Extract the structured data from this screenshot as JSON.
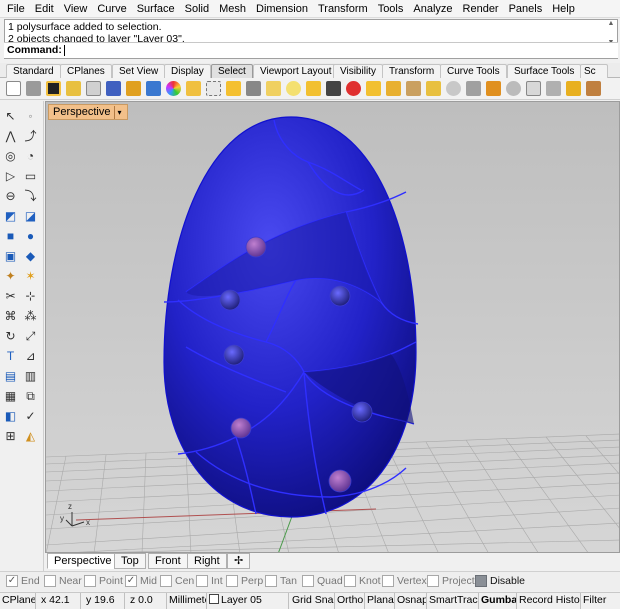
{
  "menu": [
    "File",
    "Edit",
    "View",
    "Curve",
    "Surface",
    "Solid",
    "Mesh",
    "Dimension",
    "Transform",
    "Tools",
    "Analyze",
    "Render",
    "Panels",
    "Help"
  ],
  "command_history": [
    "1 polysurface added to selection.",
    "2 objects changed to layer \"Layer 03\"."
  ],
  "command_prompt": "Command:",
  "toolbar_tabs": [
    "Standard",
    "CPlanes",
    "Set View",
    "Display",
    "Select",
    "Viewport Layout",
    "Visibility",
    "Transform",
    "Curve Tools",
    "Surface Tools",
    "Sc"
  ],
  "active_toolbar_tab": "Select",
  "viewport": {
    "title": "Perspective",
    "dropdown_glyph": "▾",
    "axis_x": "x",
    "axis_y": "y",
    "axis_z": "z"
  },
  "viewport_tabs": [
    "Perspective",
    "Top",
    "Front",
    "Right"
  ],
  "viewport_tab_add": "✢",
  "active_viewport_tab": "Perspective",
  "osnaps": [
    {
      "label": "End",
      "checked": true
    },
    {
      "label": "Near",
      "checked": false
    },
    {
      "label": "Point",
      "checked": false
    },
    {
      "label": "Mid",
      "checked": true
    },
    {
      "label": "Cen",
      "checked": false
    },
    {
      "label": "Int",
      "checked": false
    },
    {
      "label": "Perp",
      "checked": false
    },
    {
      "label": "Tan",
      "checked": false
    },
    {
      "label": "Quad",
      "checked": false
    },
    {
      "label": "Knot",
      "checked": false
    },
    {
      "label": "Vertex",
      "checked": false
    },
    {
      "label": "Project",
      "checked": false
    }
  ],
  "osnap_disable": "Disable",
  "status": {
    "cplane": "CPlane",
    "x": "x 42.1",
    "y": "y 19.6",
    "z": "z 0.0",
    "units": "Millimete",
    "layer": "Layer 05",
    "toggles": [
      "Grid Snap",
      "Ortho",
      "Planar",
      "Osnap",
      "SmartTrack",
      "Gumball",
      "Record History",
      "Filter"
    ]
  },
  "colors": {
    "object_blue": "#2020d8",
    "viewport_bg": "#c9c9c9",
    "active_tab": "#f2c08a"
  }
}
